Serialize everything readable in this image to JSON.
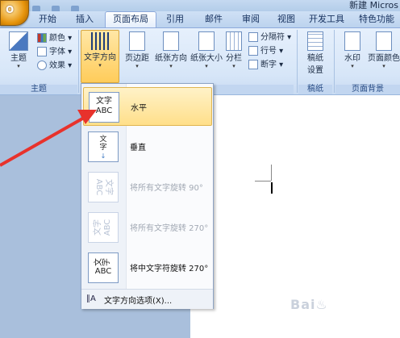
{
  "window": {
    "doc_title": "新建 Micros"
  },
  "tabs": [
    {
      "label": "开始",
      "active": false
    },
    {
      "label": "插入",
      "active": false
    },
    {
      "label": "页面布局",
      "active": true
    },
    {
      "label": "引用",
      "active": false
    },
    {
      "label": "邮件",
      "active": false
    },
    {
      "label": "审阅",
      "active": false
    },
    {
      "label": "视图",
      "active": false
    },
    {
      "label": "开发工具",
      "active": false
    },
    {
      "label": "特色功能",
      "active": false
    }
  ],
  "ribbon": {
    "theme": {
      "button_label": "主题",
      "colors_label": "颜色",
      "fonts_label": "字体",
      "effects_label": "效果",
      "group_label": "主题"
    },
    "page_setup": {
      "text_direction_label": "文字方向",
      "margins_label": "页边距",
      "orientation_label": "纸张方向",
      "size_label": "纸张大小",
      "columns_label": "分栏",
      "breaks_label": "分隔符",
      "line_numbers_label": "行号",
      "hyphenation_label": "断字"
    },
    "manuscript": {
      "button_label": "稿纸设置",
      "group_label": "稿纸"
    },
    "background": {
      "watermark_label": "水印",
      "page_color_label": "页面颜色",
      "group_label": "页面背景"
    }
  },
  "menu": {
    "items": [
      {
        "label": "水平",
        "icon_text": "文字ABC",
        "enabled": true,
        "selected": true
      },
      {
        "label": "垂直",
        "icon_text": "文字",
        "enabled": true,
        "selected": false
      },
      {
        "label": "将所有文字旋转 90°",
        "icon_text": "文字ABC",
        "enabled": false,
        "selected": false
      },
      {
        "label": "将所有文字旋转 270°",
        "icon_text": "文字ABC",
        "enabled": false,
        "selected": false
      },
      {
        "label": "将中文字符旋转 270°",
        "icon_text": "文字ABC",
        "enabled": true,
        "selected": false
      }
    ],
    "options_label": "文字方向选项(X)..."
  },
  "colors": {
    "annotation_arrow": "#e8322c",
    "ribbon_bg": "#dbe8f9",
    "highlight": "#ffd77a"
  }
}
